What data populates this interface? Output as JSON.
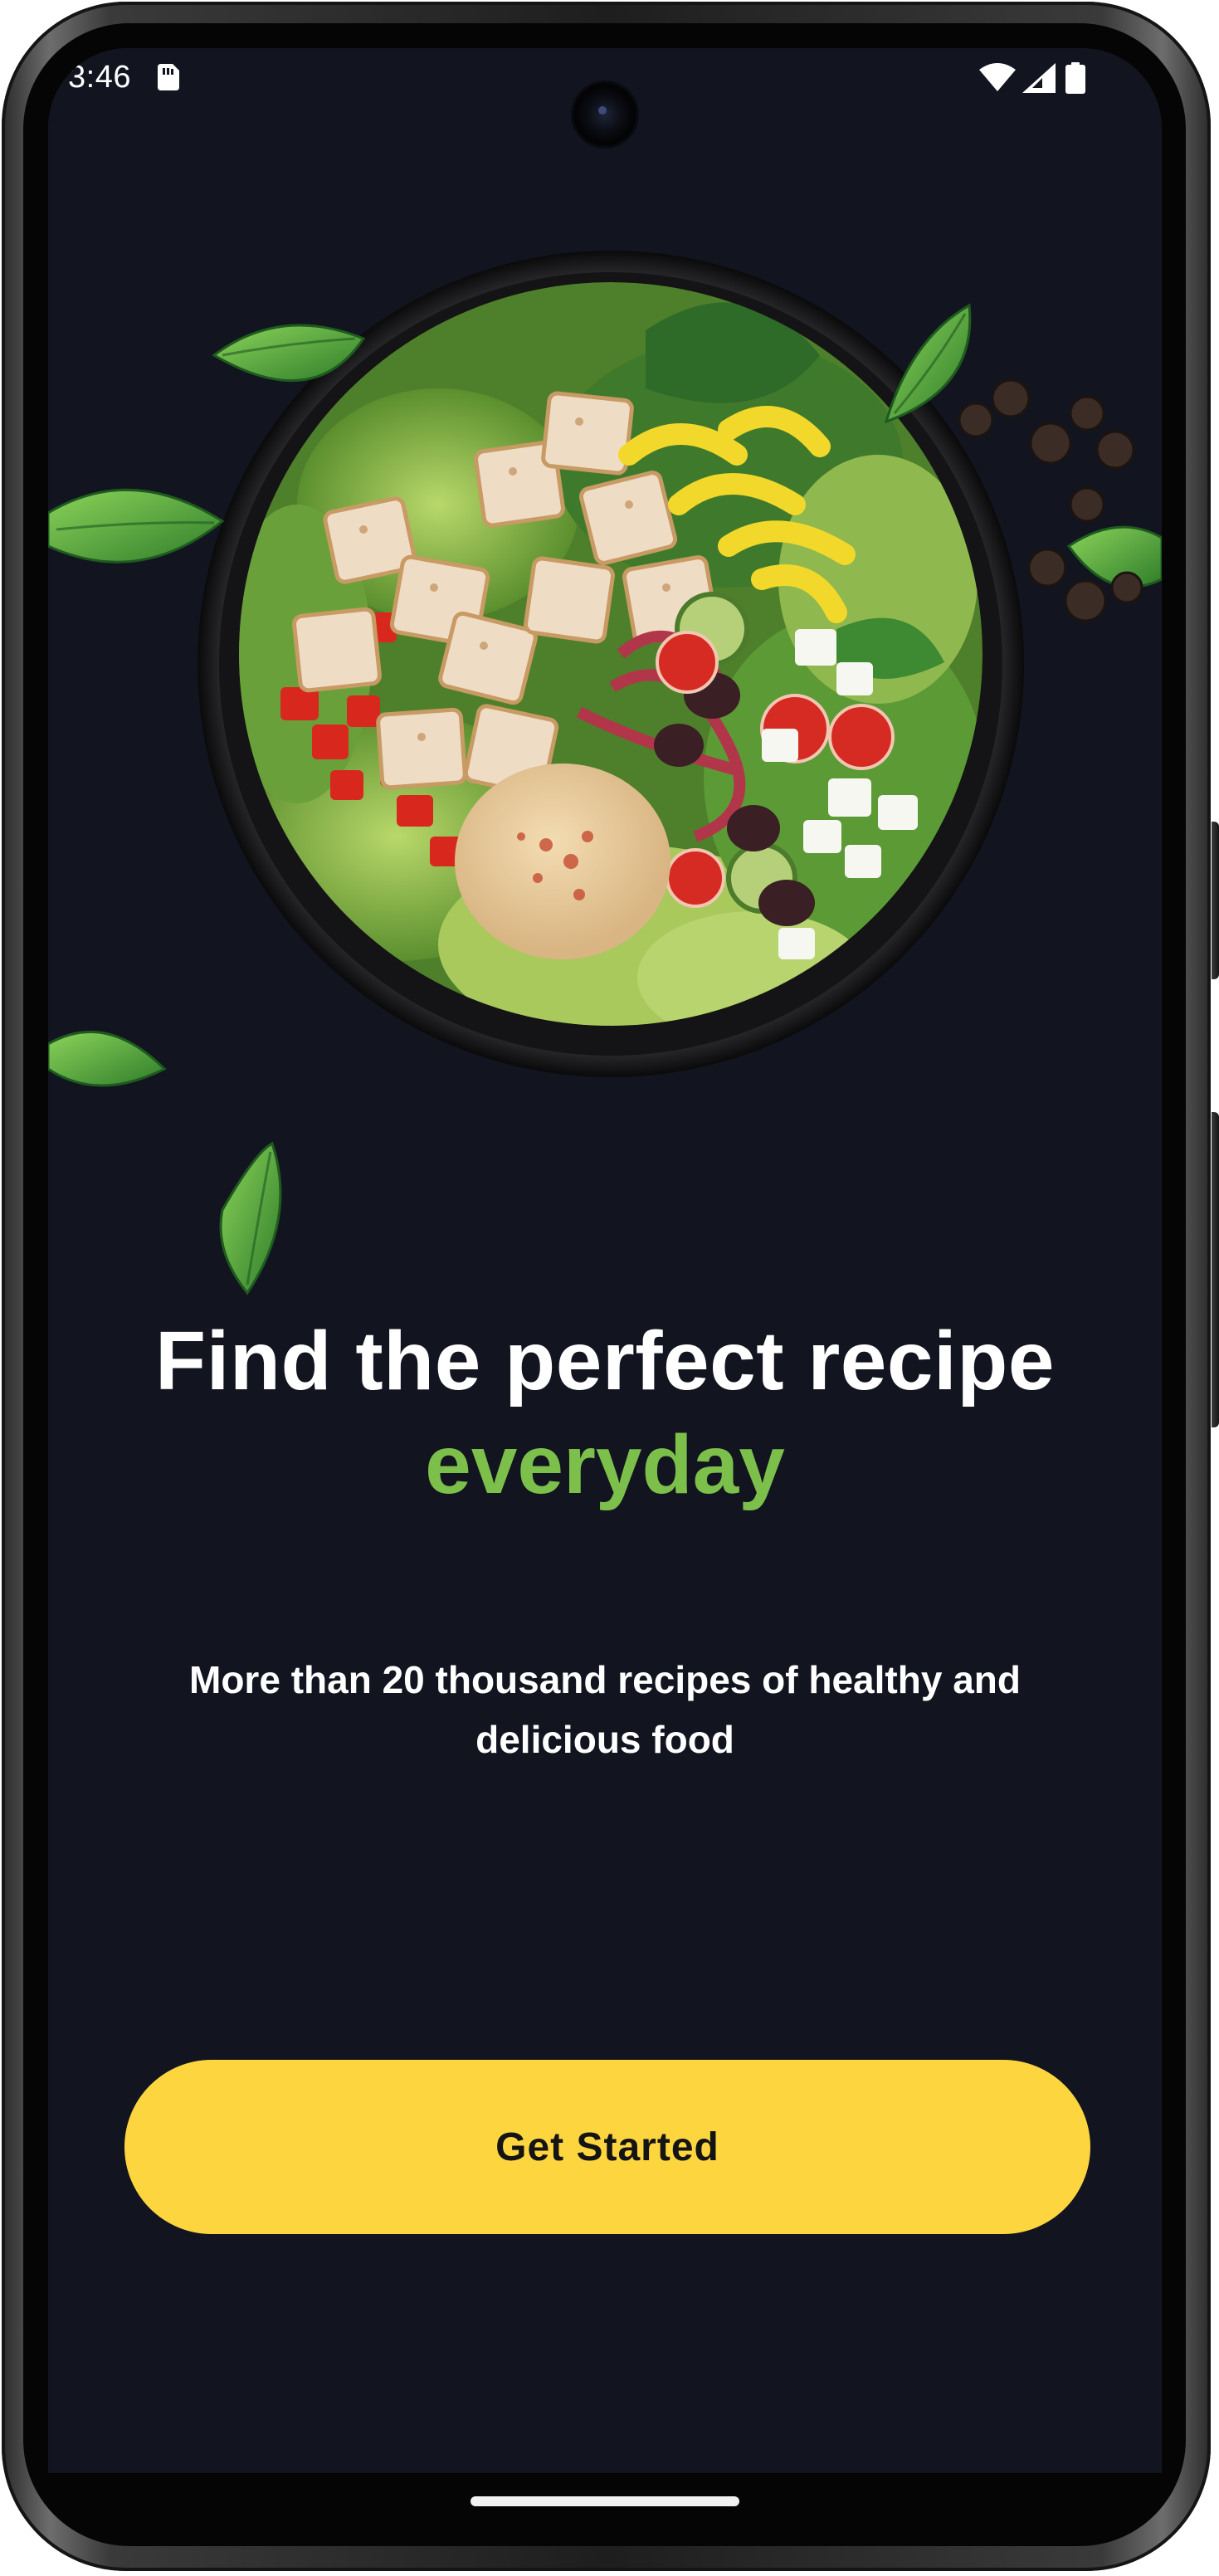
{
  "status_bar": {
    "time": "3:46",
    "icons": [
      "sim-card-icon",
      "wifi-icon",
      "signal-icon",
      "battery-icon"
    ]
  },
  "hero": {
    "image": "salad-bowl-illustration",
    "decorations": [
      "basil-leaf-icon",
      "black-peppercorns"
    ]
  },
  "headline": {
    "line1": "Find the perfect recipe",
    "accent": "everyday"
  },
  "subtitle": "More than 20 thousand recipes of healthy and delicious food",
  "cta": {
    "label": "Get Started"
  },
  "colors": {
    "background": "#121520",
    "accent_green": "#7cc04b",
    "button_yellow": "#fdd53f",
    "button_text": "#141414",
    "text_primary": "#ffffff"
  }
}
